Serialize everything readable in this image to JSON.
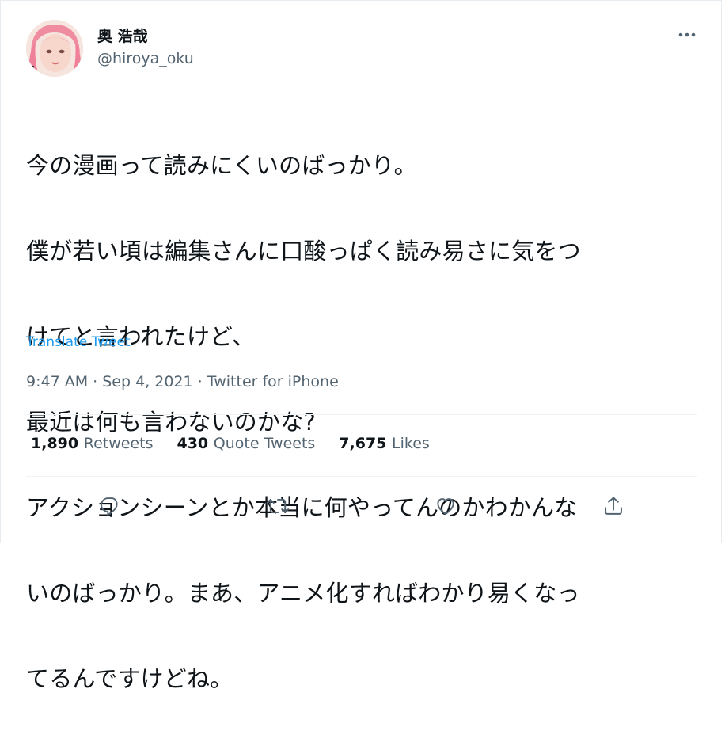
{
  "author": {
    "display_name": "奥 浩哉",
    "handle": "@hiroya_oku",
    "avatar": "avatar-photo"
  },
  "more_icon": "more-horizontal-icon",
  "tweet": {
    "lines": [
      "今の漫画って読みにくいのばっかり。",
      "僕が若い頃は編集さんに口酸っぱく読み易さに気をつ",
      "けてと言われたけど、",
      "最近は何も言わないのかな?",
      "アクションシーンとか本当に何やってんのかわかんな",
      "いのばっかり。まあ、アニメ化すればわかり易くなっ",
      "てるんですけどね。"
    ],
    "translate_label": "Translate Tweet"
  },
  "meta": {
    "time": "9:47 AM",
    "separator": "·",
    "date": "Sep 4, 2021",
    "source": "Twitter for iPhone"
  },
  "stats": {
    "retweets": {
      "count": "1,890",
      "label": "Retweets"
    },
    "quotes": {
      "count": "430",
      "label": "Quote Tweets"
    },
    "likes": {
      "count": "7,675",
      "label": "Likes"
    }
  },
  "actions": {
    "reply": "reply-icon",
    "retweet": "retweet-icon",
    "like": "heart-icon",
    "share": "share-icon"
  },
  "colors": {
    "text": "#0f1419",
    "muted": "#536471",
    "link": "#1d9bf0",
    "border": "#eff3f4"
  }
}
